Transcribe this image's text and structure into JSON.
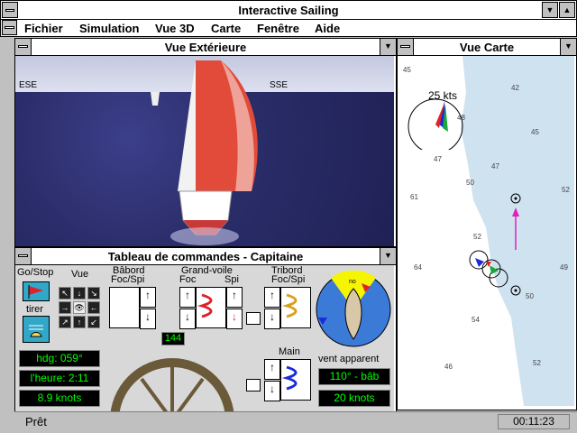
{
  "app": {
    "title": "Interactive Sailing"
  },
  "menu": {
    "items": [
      "Fichier",
      "Simulation",
      "Vue 3D",
      "Carte",
      "Fenêtre",
      "Aide"
    ]
  },
  "exterior": {
    "title": "Vue Extérieure",
    "compass_left": "ESE",
    "compass_right": "SSE"
  },
  "map": {
    "title": "Vue Carte",
    "wind_speed": "25 kts",
    "depths": [
      "45",
      "42",
      "48",
      "45",
      "47",
      "47",
      "50",
      "61",
      "52",
      "64",
      "52",
      "49",
      "50",
      "54",
      "46",
      "52"
    ]
  },
  "controls": {
    "title": "Tableau de commandes  - Capitaine",
    "go_stop": "Go/Stop",
    "tirer": "tirer",
    "vue": "Vue",
    "babord": "Bâbord",
    "foc_spi_left": "Foc/Spi",
    "grand_voile": "Grand-voile",
    "foc": "Foc",
    "spi": "Spi",
    "tribord": "Tribord",
    "foc_spi_right": "Foc/Spi",
    "main": "Main",
    "vent_apparent": "vent apparent",
    "heading": "hdg: 059°",
    "time": "l'heure: 2:11",
    "speed": "8.9  knots",
    "wheel_value": "144",
    "wind_angle": "110° - bâb",
    "wind_speed": "20  knots",
    "gauge_no": "no"
  },
  "status": {
    "text": "Prêt",
    "clock": "00:11:23"
  },
  "colors": {
    "spinnaker": "#e24a3a",
    "readout_text": "#00ff00",
    "flag": "#e0202a",
    "track": "#e020c0"
  }
}
